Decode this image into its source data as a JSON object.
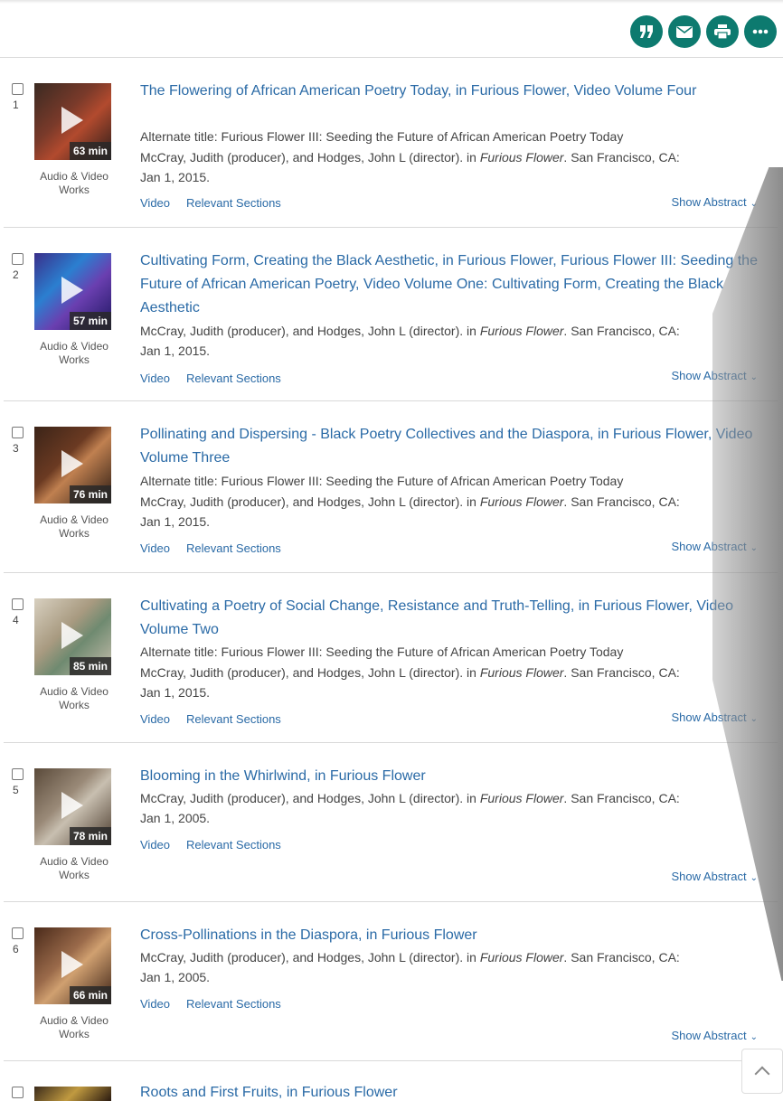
{
  "toolbar": {
    "buttons": [
      {
        "name": "cite-button",
        "icon": "quote-icon"
      },
      {
        "name": "email-button",
        "icon": "email-icon"
      },
      {
        "name": "print-button",
        "icon": "print-icon"
      },
      {
        "name": "more-button",
        "icon": "more-icon"
      }
    ],
    "accent": "#0d7a6f"
  },
  "results": [
    {
      "num": "1",
      "duration": "63 min",
      "content_type": "Audio & Video Works",
      "title": "The Flowering of African American Poetry Today, in Furious Flower, Video Volume Four",
      "alt_title": "Alternate title: Furious Flower III: Seeding the Future of African American Poetry Today",
      "byline_pre": "McCray, Judith (producer), and Hodges, John L (director). in ",
      "byline_em": "Furious Flower",
      "byline_post": ". San Francisco, CA:",
      "date": "Jan 1, 2015.",
      "link_video": "Video",
      "link_sections": "Relevant Sections",
      "show_abstract": "Show Abstract"
    },
    {
      "num": "2",
      "duration": "57 min",
      "content_type": "Audio & Video Works",
      "title": "Cultivating Form, Creating the Black Aesthetic, in Furious Flower, Furious Flower III: Seeding the Future of African American Poetry, Video Volume One: Cultivating Form, Creating the Black Aesthetic",
      "byline_pre": "McCray, Judith (producer), and Hodges, John L (director). in ",
      "byline_em": "Furious Flower",
      "byline_post": ". San Francisco, CA:",
      "date": "Jan 1, 2015.",
      "link_video": "Video",
      "link_sections": "Relevant Sections",
      "show_abstract": "Show Abstract"
    },
    {
      "num": "3",
      "duration": "76 min",
      "content_type": "Audio & Video Works",
      "title": "Pollinating and Dispersing - Black Poetry Collectives and the Diaspora, in Furious Flower, Video Volume Three",
      "alt_title": "Alternate title: Furious Flower III: Seeding the Future of African American Poetry Today",
      "byline_pre": "McCray, Judith (producer), and Hodges, John L (director). in ",
      "byline_em": "Furious Flower",
      "byline_post": ". San Francisco, CA:",
      "date": "Jan 1, 2015.",
      "link_video": "Video",
      "link_sections": "Relevant Sections",
      "show_abstract": "Show Abstract"
    },
    {
      "num": "4",
      "duration": "85 min",
      "content_type": "Audio & Video Works",
      "title": "Cultivating a Poetry of Social Change, Resistance and Truth-Telling, in Furious Flower, Video Volume Two",
      "alt_title": "Alternate title: Furious Flower III: Seeding the Future of African American Poetry Today",
      "byline_pre": "McCray, Judith (producer), and Hodges, John L (director). in ",
      "byline_em": "Furious Flower",
      "byline_post": ". San Francisco, CA:",
      "date": "Jan 1, 2015.",
      "link_video": "Video",
      "link_sections": "Relevant Sections",
      "show_abstract": "Show Abstract"
    },
    {
      "num": "5",
      "duration": "78 min",
      "content_type": "Audio & Video Works",
      "title": "Blooming in the Whirlwind, in Furious Flower",
      "byline_pre": "McCray, Judith (producer), and Hodges, John L (director). in ",
      "byline_em": "Furious Flower",
      "byline_post": ". San Francisco, CA:",
      "date": "Jan 1, 2005.",
      "link_video": "Video",
      "link_sections": "Relevant Sections",
      "show_abstract": "Show Abstract"
    },
    {
      "num": "6",
      "duration": "66 min",
      "content_type": "Audio & Video Works",
      "title": "Cross-Pollinations in the Diaspora, in Furious Flower",
      "byline_pre": "McCray, Judith (producer), and Hodges, John L (director). in ",
      "byline_em": "Furious Flower",
      "byline_post": ". San Francisco, CA:",
      "date": "Jan 1, 2005.",
      "link_video": "Video",
      "link_sections": "Relevant Sections",
      "show_abstract": "Show Abstract"
    },
    {
      "num": "",
      "title": "Roots and First Fruits, in Furious Flower"
    }
  ]
}
